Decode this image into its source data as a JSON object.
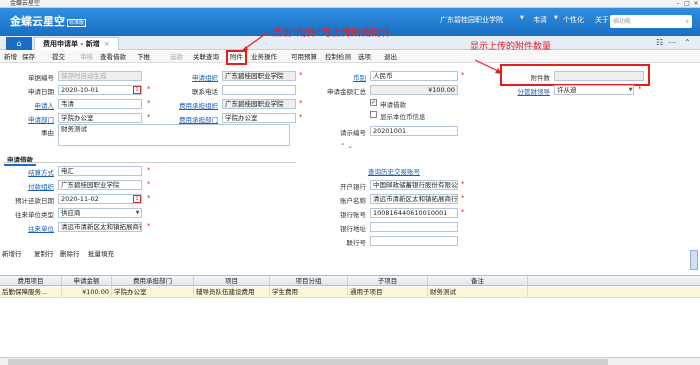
{
  "window": {
    "title": "金蝶云星空"
  },
  "header": {
    "logo": "金蝶云星空",
    "logo_sub": "标准版",
    "org": "广东碧桂园职业学院",
    "user": "韦清",
    "nav": [
      "个性化",
      "关于"
    ],
    "search_placeholder": "请输入功能名称",
    "search_short": "插功能"
  },
  "tabs": {
    "current": "费用申请单 - 新增"
  },
  "toolbar": {
    "items": [
      "新增",
      "保存",
      "提交",
      "审核",
      "查看借款",
      "下推",
      "选款",
      "关联查询",
      "附件",
      "业务操作",
      "可用预算",
      "控制检测",
      "选项",
      "退出"
    ]
  },
  "annotations": {
    "click_attachment": "点击\"附件\"可上传所需附件",
    "show_count": "显示上传的附件数量"
  },
  "form": {
    "bill_no_label": "单据编号",
    "bill_no_placeholder": "保存时自动生成",
    "apply_date_label": "申请日期",
    "apply_date": "2020-10-01",
    "applicant_label": "申请人",
    "applicant": "韦清",
    "apply_dept_label": "申请部门",
    "apply_dept": "学院办公室",
    "reason_label": "事由",
    "reason": "财务测试",
    "apply_org_label": "申请组织",
    "apply_org": "广东碧桂园职业学院",
    "contact_label": "联系电话",
    "cost_org_label": "费用承担组织",
    "cost_org": "广东碧桂园职业学院",
    "cost_dept_label": "费用承担部门",
    "cost_dept": "学院办公室",
    "currency_label": "币别",
    "currency": "人民币",
    "amount_total_label": "申请金额汇总",
    "amount_total": "¥100.00",
    "loan_checkbox": "申请借款",
    "show_unit_checkbox": "显示本位币信息",
    "attachment_count_label": "附件数",
    "treasurer_label": "分管财领导",
    "treasurer": "许从迪",
    "req_no_label": "请示编号",
    "req_no": "20201001"
  },
  "loan_section": {
    "tab_label": "申请借款",
    "settle_label": "结算方式",
    "settle": "电汇",
    "pay_org_label": "付款组织",
    "pay_org": "广东碧桂园职业学院",
    "return_date_label": "预计还款日期",
    "return_date": "2020-11-02",
    "contact_type_label": "往来单位类型",
    "contact_type": "供应商",
    "contact_unit_label": "往来单位",
    "contact_unit": "清远市清新区太和镇拓展商行",
    "history_link": "查询历史交易账号",
    "bank_label": "开户银行",
    "bank": "中国邮政储蓄银行股份有限公司",
    "account_name_label": "账户名称",
    "account_name": "清远市清新区太和镇拓展商行",
    "account_no_label": "银行账号",
    "account_no": "100816440610010001",
    "bank_addr_label": "银行地址",
    "bank_code_label": "联行号"
  },
  "grid_toolbar": [
    "新增行",
    "复制行",
    "删除行",
    "批量填充"
  ],
  "grid": {
    "columns": [
      "费用项目",
      "申请金额",
      "费用承担部门",
      "项目",
      "项目分组",
      "子项目",
      "备注"
    ],
    "rows": [
      [
        "后勤保障服务...",
        "¥100.00",
        "学院办公室",
        "辅导员队伍建设费用",
        "学生费用",
        "通用子项目",
        "财务测试"
      ]
    ]
  },
  "colors": {
    "brand_blue": "#1a6ec2",
    "annotation_red": "#e41e1e",
    "row_highlight": "#fcf6d8"
  }
}
